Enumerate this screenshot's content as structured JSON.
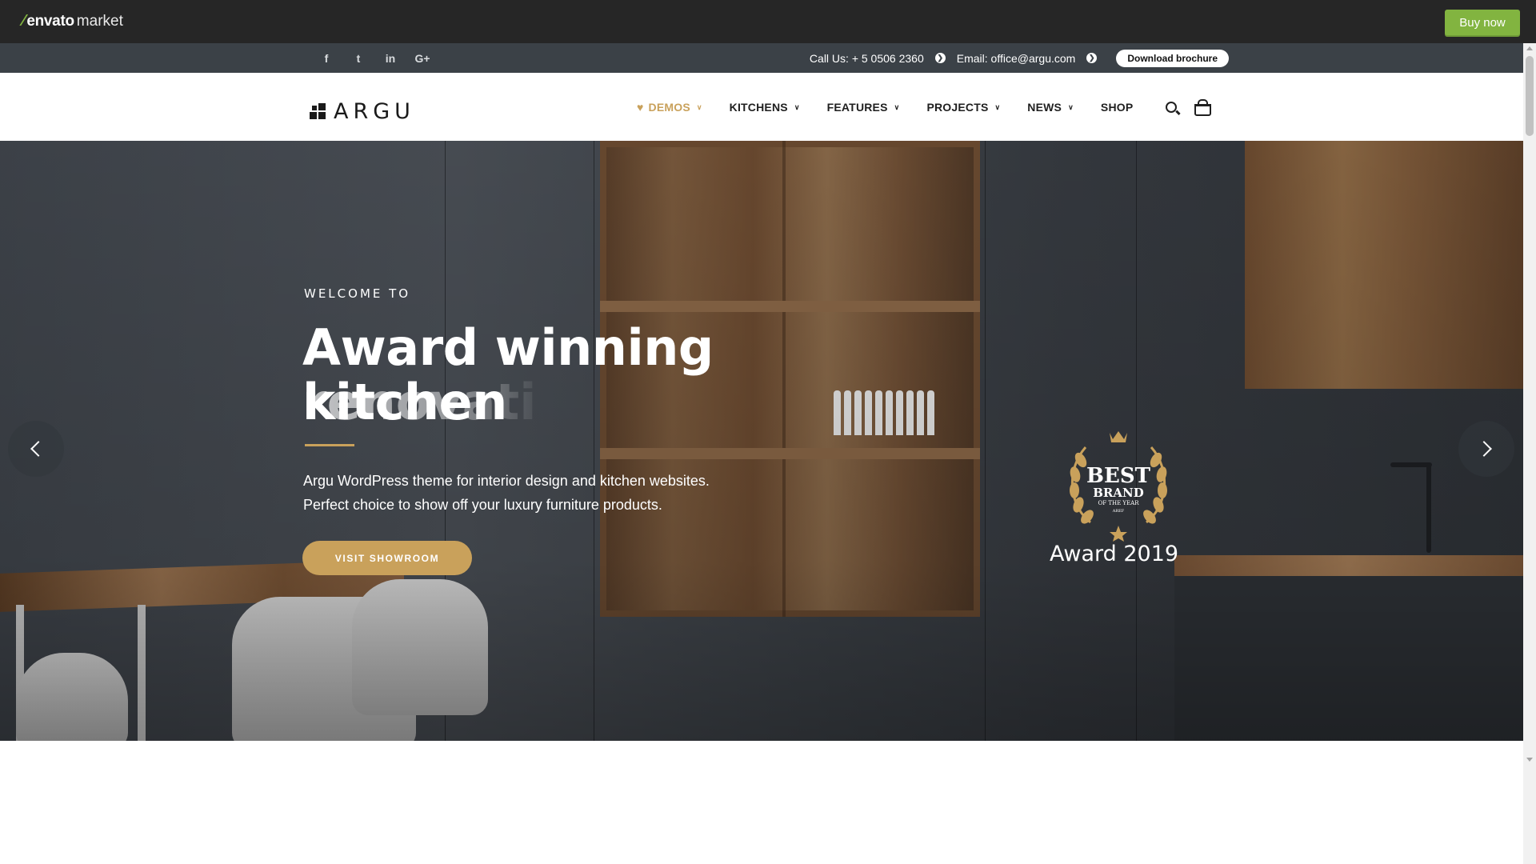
{
  "envato": {
    "logo_strong": "envato",
    "logo_light": "market",
    "buy_label": "Buy now"
  },
  "topbar": {
    "social": [
      "f",
      "t",
      "in",
      "G+"
    ],
    "social_icons": [
      "facebook-icon",
      "twitter-icon",
      "linkedin-icon",
      "google-plus-icon"
    ],
    "call": "Call Us: + 5 0506 2360",
    "email": "Email: office@argu.com",
    "brochure": "Download brochure"
  },
  "brand": {
    "name": "ARGU"
  },
  "nav": {
    "items": [
      {
        "label": "DEMOS",
        "has_dropdown": true,
        "active": true
      },
      {
        "label": "KITCHENS",
        "has_dropdown": true
      },
      {
        "label": "FEATURES",
        "has_dropdown": true
      },
      {
        "label": "PROJECTS",
        "has_dropdown": true
      },
      {
        "label": "NEWS",
        "has_dropdown": true
      },
      {
        "label": "SHOP",
        "has_dropdown": false
      }
    ],
    "icons": [
      "search-icon",
      "basket-icon"
    ]
  },
  "hero": {
    "welcome": "WELCOME TO",
    "headline_line1": "Award winning kitchen",
    "headline_line2": "renovati",
    "subtitle_line1": "Argu WordPress theme for interior design and kitchen websites.",
    "subtitle_line2": "Perfect choice to show off your luxury furniture products.",
    "cta": "VISIT SHOWROOM",
    "award_badge_text": [
      "BEST",
      "BRAND",
      "OF THE YEAR",
      "AREF"
    ],
    "award_label": "Award 2019"
  },
  "colors": {
    "accent_gold": "#c9a15b",
    "envato_green": "#82b440",
    "topbar_bg": "#3b4147",
    "envato_bar_bg": "#262626"
  }
}
